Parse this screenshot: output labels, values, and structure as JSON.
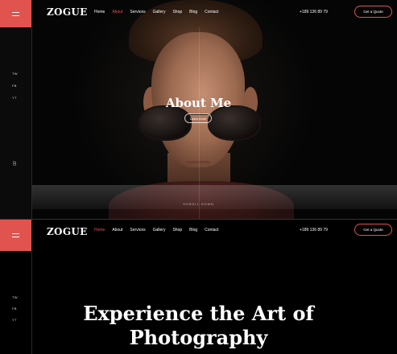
{
  "brand": {
    "logo": "ZOGUE",
    "accent": "#e1534e"
  },
  "nav": [
    "Home",
    "About",
    "Services",
    "Gallery",
    "Shop",
    "Blog",
    "Contact"
  ],
  "header": {
    "phone": "+189 136 89 79",
    "quote_label": "Get a Quote"
  },
  "social": [
    "TW",
    "FB",
    "YT"
  ],
  "slider": {
    "counter": "02"
  },
  "hero": {
    "title": "About Me",
    "button": "Learn more",
    "scroll": "SCROLL DOWN",
    "image": "portrait-man-sunglasses"
  },
  "bottom_nav_active": "Home",
  "top_nav_active": "About",
  "section": {
    "title_line1": "Experience the Art of",
    "title_line2": "Photography"
  }
}
